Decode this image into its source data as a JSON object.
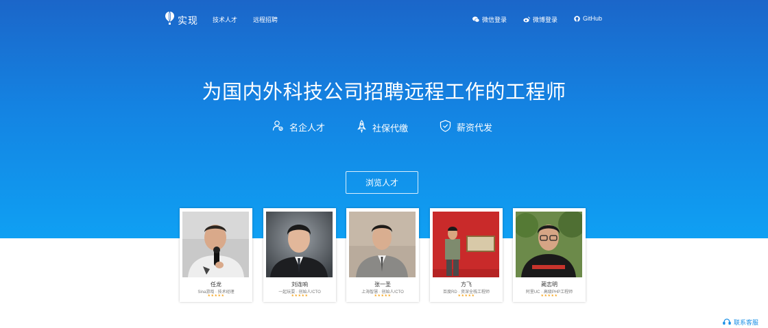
{
  "nav": {
    "brand": "实现",
    "links": [
      {
        "label": "技术人才"
      },
      {
        "label": "远程招聘"
      }
    ],
    "login": [
      {
        "label": "微信登录",
        "icon": "wechat-icon"
      },
      {
        "label": "微博登录",
        "icon": "weibo-icon"
      },
      {
        "label": "GitHub",
        "icon": "github-icon"
      }
    ]
  },
  "hero": {
    "headline": "为国内外科技公司招聘远程工作的工程师",
    "features": [
      {
        "label": "名企人才",
        "icon": "user-badge-icon"
      },
      {
        "label": "社保代缴",
        "icon": "rocket-icon"
      },
      {
        "label": "薪资代发",
        "icon": "shield-check-icon"
      }
    ],
    "browse_label": "浏览人才"
  },
  "candidates": [
    {
      "name": "任龙",
      "title": "Sina游戏 · 技术经理",
      "stars": "★★★★★"
    },
    {
      "name": "刘连响",
      "title": "一起玩耍 · 创始人/CTO",
      "stars": "★★★★★"
    },
    {
      "name": "张一圣",
      "title": "上海智慧 · 创始人/CTO",
      "stars": "★★★★★"
    },
    {
      "name": "方飞",
      "title": "百度RD · 资深全栈工程师",
      "stars": "★★★★★"
    },
    {
      "name": "蔺志明",
      "title": "阿里UC · 高级PHP工程师",
      "stars": "★★★★★"
    }
  ],
  "contact": {
    "label": "联系客服",
    "icon": "support-icon"
  },
  "colors": {
    "hero_top": "#1b66c9",
    "hero_bottom": "#0fa0f3",
    "star": "#f5a623",
    "link": "#1a90e6"
  }
}
